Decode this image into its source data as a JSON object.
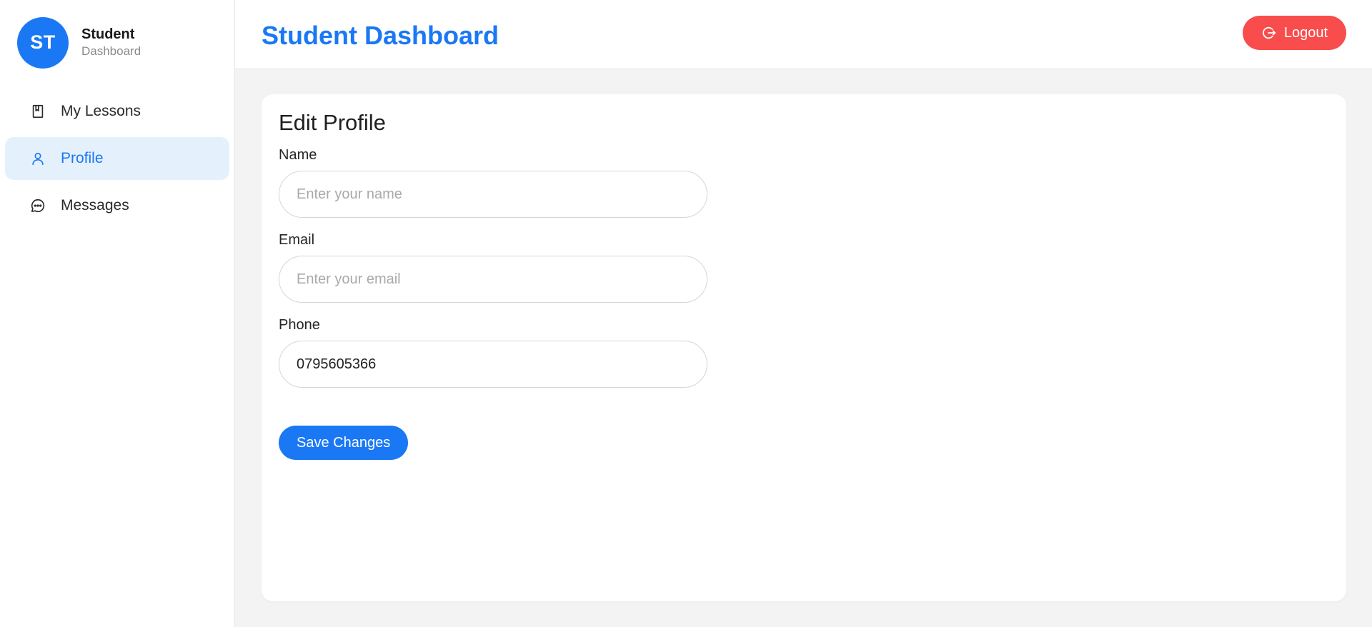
{
  "sidebar": {
    "avatar_initials": "ST",
    "brand_title": "Student",
    "brand_subtitle": "Dashboard",
    "items": [
      {
        "label": "My Lessons",
        "icon": "book-icon",
        "active": false
      },
      {
        "label": "Profile",
        "icon": "user-icon",
        "active": true
      },
      {
        "label": "Messages",
        "icon": "chat-bubble-icon",
        "active": false
      }
    ]
  },
  "header": {
    "title": "Student Dashboard",
    "logout_label": "Logout",
    "logout_icon": "logout-icon"
  },
  "form": {
    "title": "Edit Profile",
    "name": {
      "label": "Name",
      "placeholder": "Enter your name",
      "value": ""
    },
    "email": {
      "label": "Email",
      "placeholder": "Enter your email",
      "value": ""
    },
    "phone": {
      "label": "Phone",
      "placeholder": "",
      "value": "0795605366"
    },
    "save_label": "Save Changes"
  },
  "colors": {
    "primary": "#1a78f5",
    "danger": "#f94c4c",
    "active_bg": "#e4f1fd",
    "page_bg": "#f3f3f3"
  }
}
